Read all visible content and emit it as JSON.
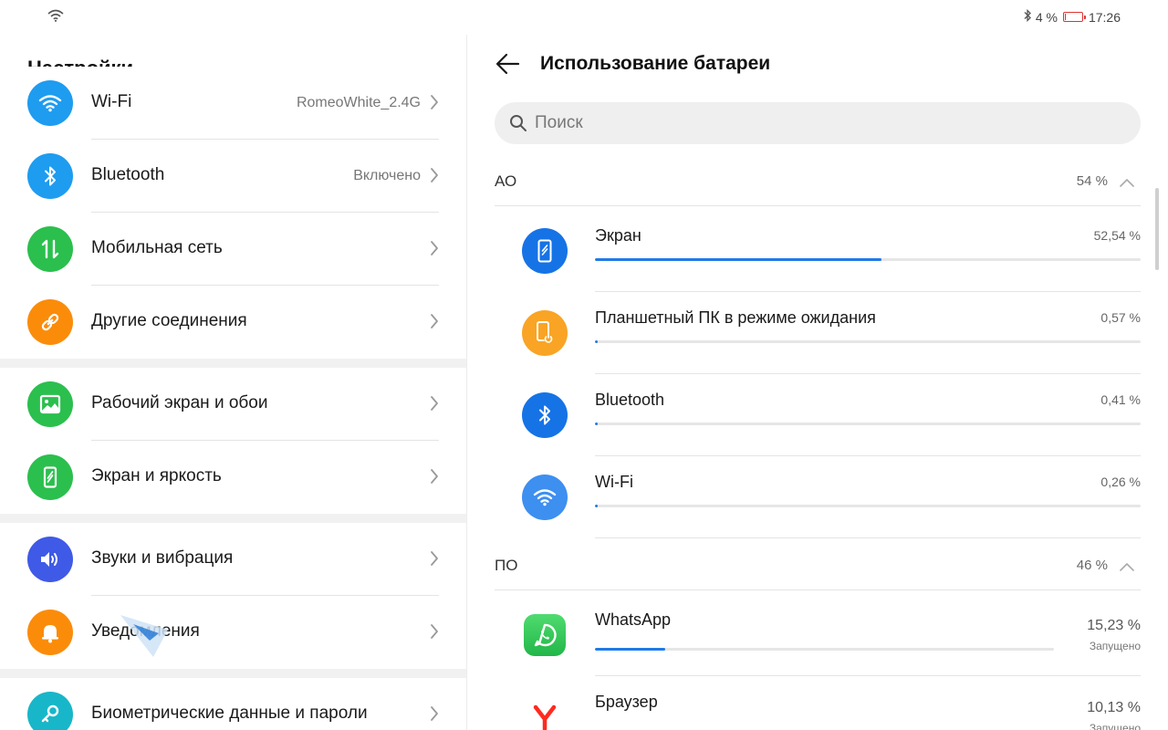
{
  "status": {
    "battery_percent": "4 %",
    "battery_level": 0.04,
    "time": "17:26"
  },
  "settings": {
    "title": "Настройки",
    "rows": [
      {
        "label": "Wi-Fi",
        "value": "RomeoWhite_2.4G",
        "icon": "wifi-icon",
        "color": "#1e9cf0"
      },
      {
        "label": "Bluetooth",
        "value": "Включено",
        "icon": "bluetooth-icon",
        "color": "#1e9cf0"
      },
      {
        "label": "Мобильная сеть",
        "value": "",
        "icon": "mobile-data-icon",
        "color": "#2bbf4e"
      },
      {
        "label": "Другие соединения",
        "value": "",
        "icon": "link-icon",
        "color": "#fb8c0a"
      },
      {
        "label": "Рабочий экран и обои",
        "value": "",
        "icon": "wallpaper-icon",
        "color": "#2bbf4e"
      },
      {
        "label": "Экран и яркость",
        "value": "",
        "icon": "display-icon",
        "color": "#2bbf4e"
      },
      {
        "label": "Звуки и вибрация",
        "value": "",
        "icon": "sound-icon",
        "color": "#3f5ae6"
      },
      {
        "label": "Уведомления",
        "value": "",
        "icon": "bell-icon",
        "color": "#fb8c0a"
      },
      {
        "label": "Биометрические данные и пароли",
        "value": "",
        "icon": "key-icon",
        "color": "#18b6c9"
      }
    ]
  },
  "battery": {
    "title": "Использование батареи",
    "search_placeholder": "Поиск",
    "hw": {
      "name": "АО",
      "percent": "54 %",
      "items": [
        {
          "name": "Экран",
          "percent": "52,54 %",
          "level": 0.5254,
          "icon": "screen-icon",
          "color": "#1673e6"
        },
        {
          "name": "Планшетный ПК в режиме ожидания",
          "percent": "0,57 %",
          "level": 0.0057,
          "icon": "standby-icon",
          "color": "#f9a425"
        },
        {
          "name": "Bluetooth",
          "percent": "0,41 %",
          "level": 0.0041,
          "icon": "bluetooth-icon",
          "color": "#1673e6"
        },
        {
          "name": "Wi-Fi",
          "percent": "0,26 %",
          "level": 0.0026,
          "icon": "wifi-icon",
          "color": "#3d8ff0"
        }
      ]
    },
    "sw": {
      "name": "ПО",
      "percent": "46 %",
      "items": [
        {
          "name": "WhatsApp",
          "percent": "15,23 %",
          "status": "Запущено",
          "level": 0.1523,
          "icon": "whatsapp-icon",
          "color": "#2ecc57"
        },
        {
          "name": "Браузер",
          "percent": "10,13 %",
          "status": "Запущено",
          "level": 0.1013,
          "icon": "yandex-browser-icon",
          "color": "#ff2a1f"
        }
      ]
    }
  }
}
